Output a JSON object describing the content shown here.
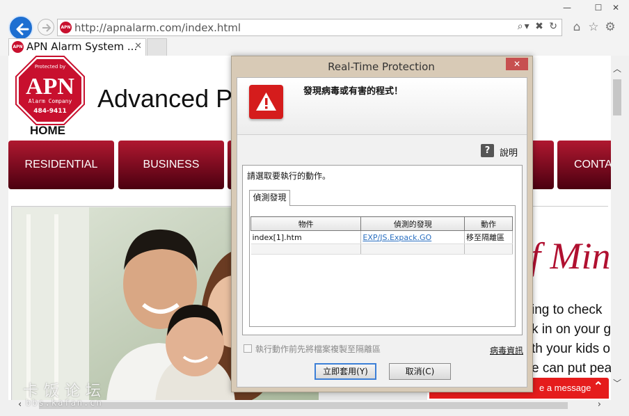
{
  "window": {
    "minimize": "—",
    "maximize": "☐",
    "close": "✕"
  },
  "browser": {
    "url": "http://apnalarm.com/index.html",
    "address_icons": "⌕▾ ✖ ↻",
    "tab_title": "APN Alarm System ...",
    "tab_close": "✕",
    "favicon_text": "APN",
    "icons": {
      "home": "⌂",
      "favorites": "☆",
      "settings": "⚙"
    }
  },
  "page": {
    "logo": {
      "top_text": "Protected by",
      "brand": "APN",
      "company": "Alarm Company",
      "phone": "484-9411",
      "home": "HOME"
    },
    "title": "Advanced P",
    "nav": [
      "RESIDENTIAL",
      "BUSINESS",
      "CONTA"
    ],
    "hero_slogan": "f Min",
    "hero_lines": [
      "ing to check",
      "k in on your g",
      "th your kids o",
      "e can put pea"
    ],
    "chat_label": "e a message",
    "chat_chevron": "⌃"
  },
  "scrollbars": {
    "up": "︿",
    "down": "﹀",
    "left": "‹",
    "right": "›"
  },
  "watermark": {
    "site_cn": "卡饭论坛",
    "url": "bbs.kafan.cn"
  },
  "dialog": {
    "title": "Real-Time Protection",
    "close": "✕",
    "heading": "發現病毒或有害的程式！",
    "help_icon": "?",
    "help_label": "說明",
    "action_prompt": "請選取要執行的動作。",
    "tab_label": "偵測發現",
    "table": {
      "headers": [
        "物件",
        "偵測的發現",
        "動作"
      ],
      "rows": [
        {
          "object": "index[1].htm",
          "detection": "EXP/JS.Expack.GO",
          "action": "移至隔離區"
        }
      ]
    },
    "copy_checkbox_label": "執行動作前先將檔案複製至隔離區",
    "virus_info_link": "病毒資訊",
    "apply_button": "立即套用(Y)",
    "cancel_button": "取消(C)"
  },
  "colors": {
    "accent_red": "#c8102e",
    "nav_red": "#8a0f24",
    "link_blue": "#2a6fc0",
    "ie_blue": "#1e6fd1"
  }
}
